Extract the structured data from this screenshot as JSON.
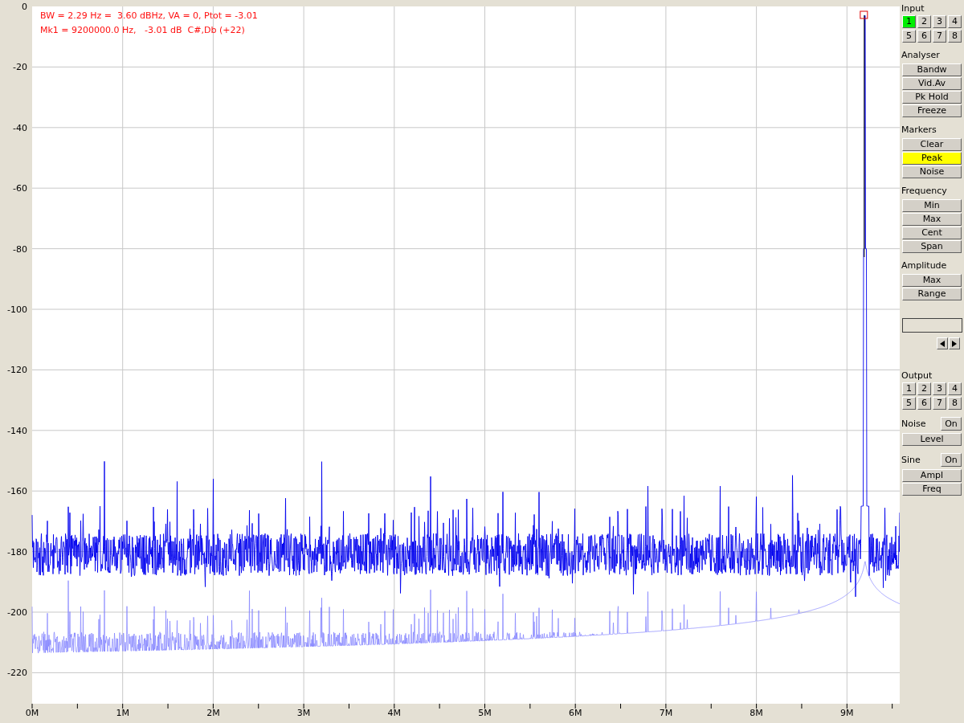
{
  "readout": [
    "BW = 2.29 Hz =  3.60 dBHz, VA = 0, Ptot = -3.01",
    "Mk1 = 9200000.0 Hz,   -3.01 dB  C#,Db (+22)"
  ],
  "y_axis": [
    "0",
    "-20",
    "-40",
    "-60",
    "-80",
    "-100",
    "-120",
    "-140",
    "-160",
    "-180",
    "-200",
    "-220"
  ],
  "x_axis": [
    "0M",
    "1M",
    "2M",
    "3M",
    "4M",
    "5M",
    "6M",
    "7M",
    "8M",
    "9M"
  ],
  "panel": [
    {
      "kind": "grid",
      "title": "Input",
      "buttons": [
        {
          "label": "1",
          "selected": true
        },
        {
          "label": "2",
          "selected": false
        },
        {
          "label": "3",
          "selected": false
        },
        {
          "label": "4",
          "selected": false
        },
        {
          "label": "5",
          "selected": false
        },
        {
          "label": "6",
          "selected": false
        },
        {
          "label": "7",
          "selected": false
        },
        {
          "label": "8",
          "selected": false
        }
      ]
    },
    {
      "kind": "list",
      "title": "Analyser",
      "buttons": [
        {
          "label": "Bandw",
          "selected": false
        },
        {
          "label": "Vid.Av",
          "selected": false
        },
        {
          "label": "Pk Hold",
          "selected": false
        },
        {
          "label": "Freeze",
          "selected": false
        }
      ]
    },
    {
      "kind": "list",
      "title": "Markers",
      "buttons": [
        {
          "label": "Clear",
          "selected": false
        },
        {
          "label": "Peak",
          "selected": true
        },
        {
          "label": "Noise",
          "selected": false
        }
      ]
    },
    {
      "kind": "list",
      "title": "Frequency",
      "buttons": [
        {
          "label": "Min",
          "selected": false
        },
        {
          "label": "Max",
          "selected": false
        },
        {
          "label": "Cent",
          "selected": false
        },
        {
          "label": "Span",
          "selected": false
        }
      ]
    },
    {
      "kind": "list",
      "title": "Amplitude",
      "buttons": [
        {
          "label": "Max",
          "selected": false
        },
        {
          "label": "Range",
          "selected": false
        }
      ]
    },
    {
      "kind": "field"
    },
    {
      "kind": "grid",
      "title": "Output",
      "buttons": [
        {
          "label": "1",
          "selected": false
        },
        {
          "label": "2",
          "selected": false
        },
        {
          "label": "3",
          "selected": false
        },
        {
          "label": "4",
          "selected": false
        },
        {
          "label": "5",
          "selected": false
        },
        {
          "label": "6",
          "selected": false
        },
        {
          "label": "7",
          "selected": false
        },
        {
          "label": "8",
          "selected": false
        }
      ]
    },
    {
      "kind": "toggle",
      "title": "Noise",
      "toggle": "On",
      "buttons": [
        {
          "label": "Level",
          "selected": false
        }
      ]
    },
    {
      "kind": "toggle",
      "title": "Sine",
      "toggle": "On",
      "buttons": [
        {
          "label": "Ampl",
          "selected": false
        },
        {
          "label": "Freq",
          "selected": false
        }
      ]
    }
  ]
}
